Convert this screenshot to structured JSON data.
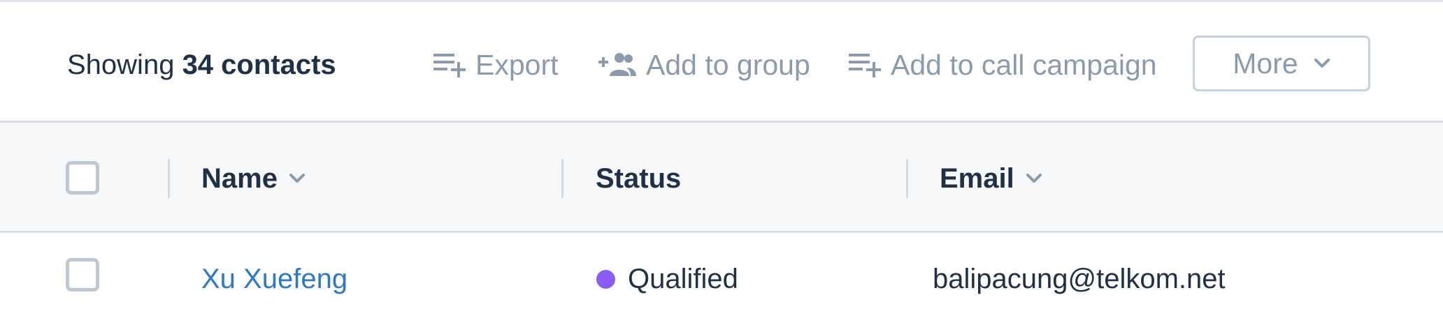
{
  "toolbar": {
    "showing_prefix": "Showing",
    "showing_count": "34 contacts",
    "actions": [
      {
        "label": "Export",
        "icon": "playlist-add-icon"
      },
      {
        "label": "Add to group",
        "icon": "group-add-icon"
      },
      {
        "label": "Add to call campaign",
        "icon": "playlist-add-icon"
      }
    ],
    "more_label": "More",
    "more_icon": "chevron-down-icon"
  },
  "table": {
    "columns": [
      {
        "label": "Name",
        "sortable": true
      },
      {
        "label": "Status",
        "sortable": false
      },
      {
        "label": "Email",
        "sortable": true
      }
    ],
    "rows": [
      {
        "selected": false,
        "name": "Xu Xuefeng",
        "status": "Qualified",
        "status_color": "#8b5cf6",
        "email": "balipacung@telkom.net"
      }
    ]
  },
  "colors": {
    "text_primary": "#1f3147",
    "text_muted": "#8a9bad",
    "link": "#2f78c4",
    "header_bg": "#f6f8fa",
    "border": "#d7dee7"
  }
}
